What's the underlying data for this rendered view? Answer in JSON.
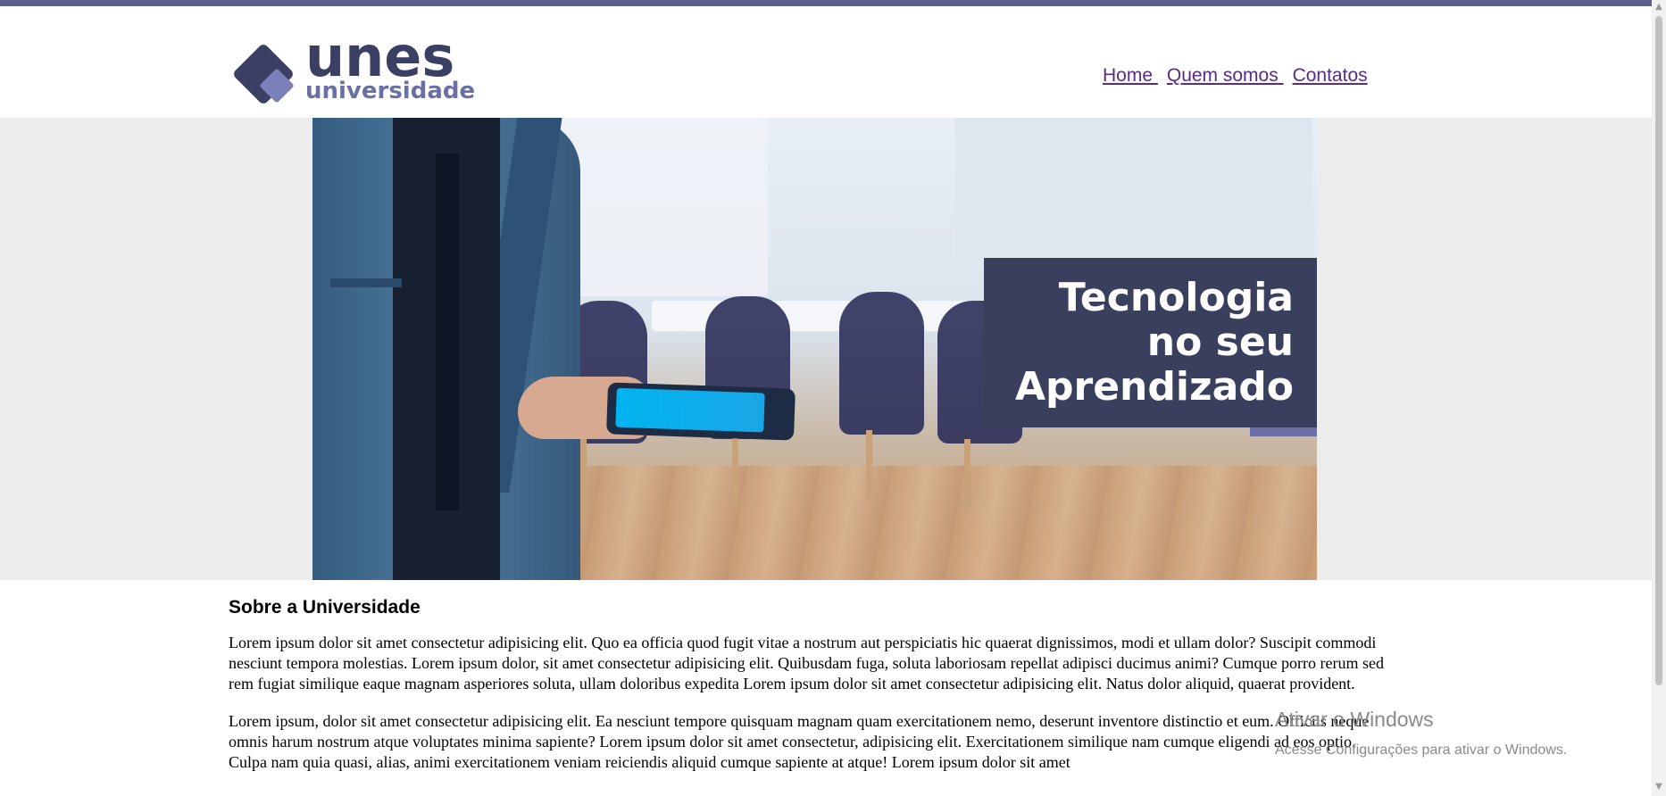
{
  "logo": {
    "wordmark": "unes",
    "subtitle": "universidade"
  },
  "nav": {
    "items": [
      {
        "label": "Home "
      },
      {
        "label": "Quem somos "
      },
      {
        "label": "Contatos"
      }
    ]
  },
  "banner": {
    "headline_line1": "Tecnologia",
    "headline_line2": "no seu",
    "headline_line3": "Aprendizado"
  },
  "about": {
    "title": "Sobre a Universidade",
    "paragraphs": [
      "Lorem ipsum dolor sit amet consectetur adipisicing elit. Quo ea officia quod fugit vitae a nostrum aut perspiciatis hic quaerat dignissimos, modi et ullam dolor? Suscipit commodi nesciunt tempora molestias. Lorem ipsum dolor, sit amet consectetur adipisicing elit. Quibusdam fuga, soluta laboriosam repellat adipisci ducimus animi? Cumque porro rerum sed rem fugiat similique eaque magnam asperiores soluta, ullam doloribus expedita Lorem ipsum dolor sit amet consectetur adipisicing elit. Natus dolor aliquid, quaerat provident.",
      "Lorem ipsum, dolor sit amet consectetur adipisicing elit. Ea nesciunt tempore quisquam magnam quam exercitationem nemo, deserunt inventore distinctio et eum. Officiis neque omnis harum nostrum atque voluptates minima sapiente? Lorem ipsum dolor sit amet consectetur, adipisicing elit. Exercitationem similique nam cumque eligendi ad eos optio. Culpa nam quia quasi, alias, animi exercitationem veniam reiciendis aliquid cumque sapiente at atque! Lorem ipsum dolor sit amet"
    ]
  },
  "watermark": {
    "title": "Ativar o Windows",
    "subtitle": "Acesse Configurações para ativar o Windows."
  },
  "colors": {
    "brand_dark": "#3a3f63",
    "brand_light": "#6a6fa5",
    "link": "#5a2a8a"
  }
}
